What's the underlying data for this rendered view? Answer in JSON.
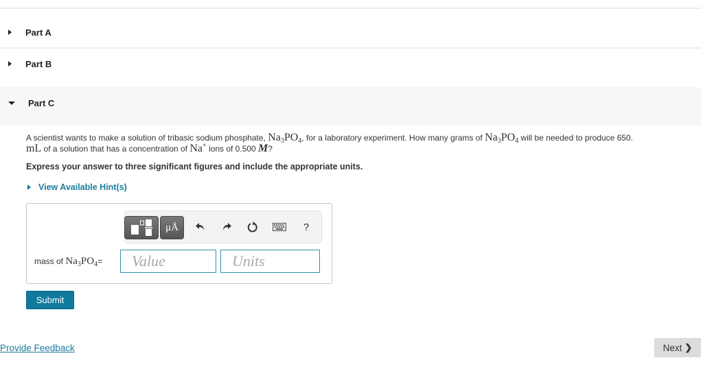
{
  "parts": [
    {
      "label": "Part A",
      "expanded": false
    },
    {
      "label": "Part B",
      "expanded": false
    },
    {
      "label": "Part C",
      "expanded": true
    }
  ],
  "question": {
    "text_1": "A scientist wants to make a solution of tribasic sodium phosphate, ",
    "formula_1": {
      "na": "Na",
      "na_sub": "3",
      "po": "PO",
      "po_sub": "4"
    },
    "text_2": ", for a laboratory experiment. How many grams of ",
    "formula_2": {
      "na": "Na",
      "na_sub": "3",
      "po": "PO",
      "po_sub": "4"
    },
    "text_3": " will be needed to produce 650.",
    "unit_ml": "mL",
    "text_4": " of a solution that has a concentration of ",
    "ion": {
      "base": "Na",
      "charge": "+"
    },
    "text_5": " ions of 0.500 ",
    "molar": "M",
    "text_6": "?"
  },
  "instruction": "Express your answer to three significant figures and include the appropriate units.",
  "hint_link": "View Available Hint(s)",
  "toolbar": {
    "buttons": [
      {
        "name": "templates",
        "icon": "fraction-template-icon"
      },
      {
        "name": "units",
        "icon": "units-icon",
        "label": "μÅ"
      },
      {
        "name": "undo",
        "icon": "undo-icon",
        "glyph": "↶"
      },
      {
        "name": "redo",
        "icon": "redo-icon",
        "glyph": "↷"
      },
      {
        "name": "reset",
        "icon": "reset-icon",
        "glyph": "↻"
      },
      {
        "name": "keyboard",
        "icon": "keyboard-icon"
      },
      {
        "name": "help",
        "icon": "help-icon",
        "glyph": "?"
      }
    ]
  },
  "answer": {
    "label_prefix": "mass of ",
    "formula": {
      "na": "Na",
      "na_sub": "3",
      "po": "PO",
      "po_sub": "4"
    },
    "label_suffix": " =",
    "value_placeholder": "Value",
    "value": "",
    "units_placeholder": "Units",
    "units": ""
  },
  "submit_label": "Submit",
  "feedback_link": "Provide Feedback",
  "next_label": "Next",
  "next_chevron": "❯",
  "colors": {
    "accent": "#0f7a9c",
    "link": "#1a7a9c",
    "expanded_bg": "#f7f7f7"
  }
}
